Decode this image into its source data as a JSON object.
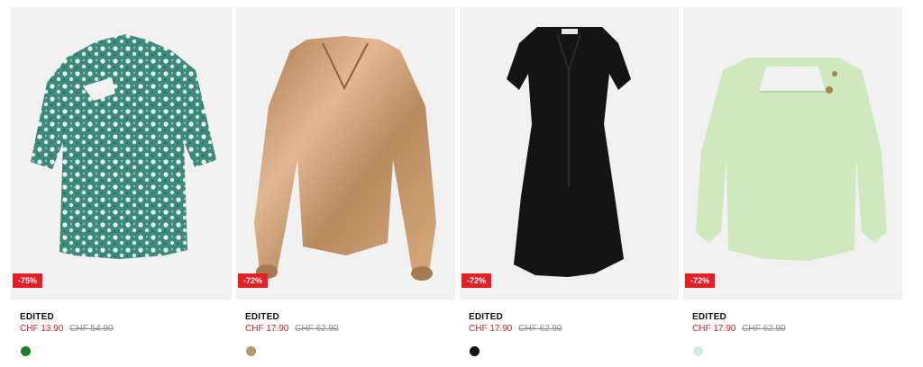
{
  "products": [
    {
      "brand": "EDITED",
      "sale_price": "CHF 13.90",
      "original_price": "CHF 54.90",
      "discount": "-75%",
      "swatch_color": "#1a7f2a",
      "image_icon": "floral-blouse-image"
    },
    {
      "brand": "EDITED",
      "sale_price": "CHF 17.90",
      "original_price": "CHF 62.90",
      "discount": "-72%",
      "swatch_color": "#b29a6a",
      "image_icon": "satin-blouse-image"
    },
    {
      "brand": "EDITED",
      "sale_price": "CHF 17.90",
      "original_price": "CHF 62.90",
      "discount": "-72%",
      "swatch_color": "#111111",
      "image_icon": "black-dress-image"
    },
    {
      "brand": "EDITED",
      "sale_price": "CHF 17.90",
      "original_price": "CHF 62.90",
      "discount": "-72%",
      "swatch_color": "#cfeedd",
      "image_icon": "green-blouse-image"
    }
  ],
  "colors": {
    "sale": "#e32028",
    "badge_bg": "#e32028",
    "image_bg": "#f1f1f1"
  }
}
